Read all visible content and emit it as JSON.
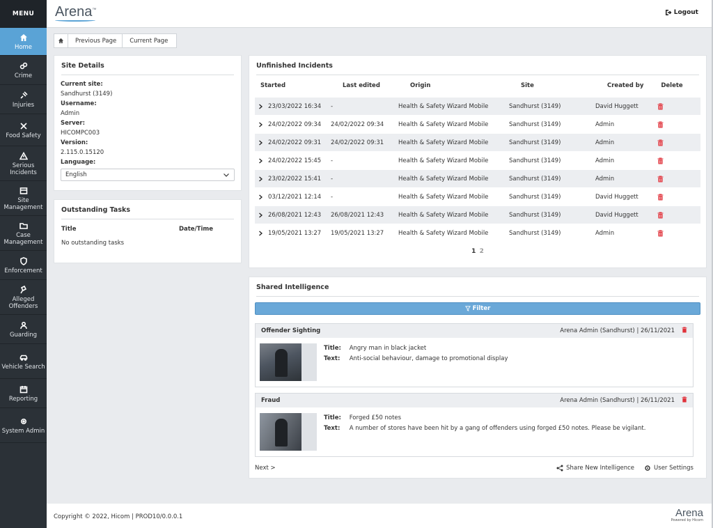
{
  "app": {
    "logo": "Arena",
    "logo_mark": "™",
    "logout_label": "Logout"
  },
  "sidebar": {
    "menu_label": "MENU",
    "items": [
      {
        "label": "Home",
        "icon": "home-icon"
      },
      {
        "label": "Crime",
        "icon": "crime-icon"
      },
      {
        "label": "Injuries",
        "icon": "injuries-icon"
      },
      {
        "label": "Food Safety",
        "icon": "food-safety-icon"
      },
      {
        "label": "Serious Incidents",
        "icon": "warning-icon"
      },
      {
        "label": "Site Management",
        "icon": "site-management-icon"
      },
      {
        "label": "Case Management",
        "icon": "folder-icon"
      },
      {
        "label": "Enforcement",
        "icon": "shield-icon"
      },
      {
        "label": "Alleged Offenders",
        "icon": "gavel-icon"
      },
      {
        "label": "Guarding",
        "icon": "guard-icon"
      },
      {
        "label": "Vehicle Search",
        "icon": "car-icon"
      },
      {
        "label": "Reporting",
        "icon": "calendar-icon"
      },
      {
        "label": "System Admin",
        "icon": "gear-icon"
      }
    ]
  },
  "breadcrumb": {
    "previous": "Previous Page",
    "current": "Current Page"
  },
  "site_details": {
    "title": "Site Details",
    "current_site_label": "Current site:",
    "current_site": "Sandhurst (3149)",
    "username_label": "Username:",
    "username": "Admin",
    "server_label": "Server:",
    "server": "HICOMPC003",
    "version_label": "Version:",
    "version": "2.115.0.15120",
    "language_label": "Language:",
    "language": "English"
  },
  "tasks": {
    "title": "Outstanding Tasks",
    "col_title": "Title",
    "col_datetime": "Date/Time",
    "empty": "No outstanding tasks"
  },
  "incidents": {
    "title": "Unfinished Incidents",
    "columns": {
      "started": "Started",
      "last_edited": "Last edited",
      "origin": "Origin",
      "site": "Site",
      "created_by": "Created by",
      "delete": "Delete"
    },
    "rows": [
      {
        "started": "23/03/2022 16:34",
        "last_edited": "-",
        "origin": "Health & Safety Wizard Mobile",
        "site": "Sandhurst (3149)",
        "created_by": "David Huggett"
      },
      {
        "started": "24/02/2022 09:34",
        "last_edited": "24/02/2022 09:34",
        "origin": "Health & Safety Wizard Mobile",
        "site": "Sandhurst (3149)",
        "created_by": "Admin"
      },
      {
        "started": "24/02/2022 09:31",
        "last_edited": "24/02/2022 09:31",
        "origin": "Health & Safety Wizard Mobile",
        "site": "Sandhurst (3149)",
        "created_by": "Admin"
      },
      {
        "started": "24/02/2022 15:45",
        "last_edited": "-",
        "origin": "Health & Safety Wizard Mobile",
        "site": "Sandhurst (3149)",
        "created_by": "Admin"
      },
      {
        "started": "23/02/2022 15:41",
        "last_edited": "-",
        "origin": "Health & Safety Wizard Mobile",
        "site": "Sandhurst (3149)",
        "created_by": "Admin"
      },
      {
        "started": "03/12/2021 12:14",
        "last_edited": "-",
        "origin": "Health & Safety Wizard Mobile",
        "site": "Sandhurst (3149)",
        "created_by": "David Huggett"
      },
      {
        "started": "26/08/2021 12:43",
        "last_edited": "26/08/2021 12:43",
        "origin": "Health & Safety Wizard Mobile",
        "site": "Sandhurst (3149)",
        "created_by": "David Huggett"
      },
      {
        "started": "19/05/2021 13:27",
        "last_edited": "19/05/2021 13:27",
        "origin": "Health & Safety Wizard Mobile",
        "site": "Sandhurst (3149)",
        "created_by": "Admin"
      }
    ],
    "pages": [
      "1",
      "2"
    ]
  },
  "intel": {
    "title": "Shared Intelligence",
    "filter_label": "Filter",
    "title_label": "Title:",
    "text_label": "Text:",
    "items": [
      {
        "type": "Offender Sighting",
        "meta": "Arena Admin (Sandhurst) | 26/11/2021",
        "title": "Angry man in black jacket",
        "text": "Anti-social behaviour, damage to promotional display"
      },
      {
        "type": "Fraud",
        "meta": "Arena Admin (Sandhurst) | 26/11/2021",
        "title": "Forged £50 notes",
        "text": "A number of stores have been hit by a gang of offenders using forged £50 notes. Please be vigilant."
      }
    ],
    "next_label": "Next >",
    "share_label": "Share New Intelligence",
    "settings_label": "User Settings"
  },
  "footer": {
    "copyright": "Copyright © 2022, Hicom | PROD10/0.0.0.1",
    "logo": "Arena",
    "powered": "Powered by Hicom"
  },
  "colors": {
    "sidebar": "#2b3137",
    "accent": "#5aa3d6",
    "delete": "#e0313a"
  }
}
